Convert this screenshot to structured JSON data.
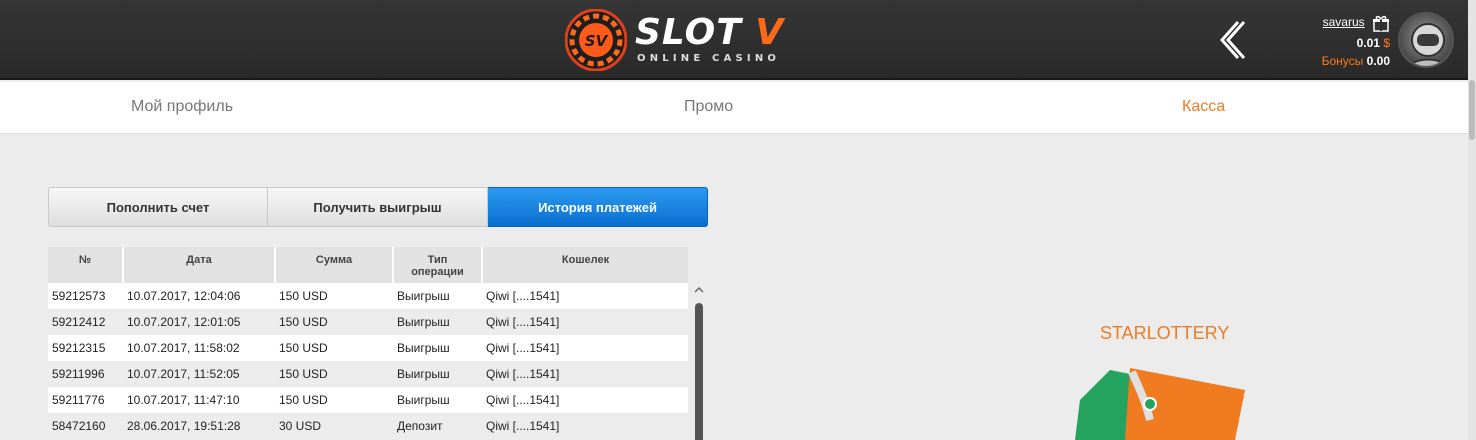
{
  "header": {
    "logo_text": "SLOT",
    "logo_letter": "V",
    "logo_sub": "ONLINE CASINO",
    "username": "savarus",
    "balance_value": "0.01",
    "balance_currency": "$",
    "bonus_label": "Бонусы",
    "bonus_value": "0.00"
  },
  "nav": {
    "profile": "Мой профиль",
    "promo": "Промо",
    "cashier": "Касса",
    "active": "cashier"
  },
  "tabs": {
    "deposit": "Пополнить счет",
    "withdraw": "Получить выигрыш",
    "history": "История платежей",
    "active": "history"
  },
  "table": {
    "headers": [
      "№",
      "Дата",
      "Сумма",
      "Тип операции",
      "Кошелек"
    ],
    "rows": [
      [
        "59212573",
        "10.07.2017, 12:04:06",
        "150 USD",
        "Выигрыш",
        "Qiwi [....1541]"
      ],
      [
        "59212412",
        "10.07.2017, 12:01:05",
        "150 USD",
        "Выигрыш",
        "Qiwi [....1541]"
      ],
      [
        "59212315",
        "10.07.2017, 11:58:02",
        "150 USD",
        "Выигрыш",
        "Qiwi [....1541]"
      ],
      [
        "59211996",
        "10.07.2017, 11:52:05",
        "150 USD",
        "Выигрыш",
        "Qiwi [....1541]"
      ],
      [
        "59211776",
        "10.07.2017, 11:47:10",
        "150 USD",
        "Выигрыш",
        "Qiwi [....1541]"
      ],
      [
        "58472160",
        "28.06.2017, 19:51:28",
        "30 USD",
        "Депозит",
        "Qiwi [....1541]"
      ]
    ]
  },
  "promo": {
    "title": "STARLOTTERY"
  },
  "colors": {
    "accent": "#f07b20",
    "active_tab": "#1a84e0",
    "header_bg": "#2f2f2f"
  },
  "icons": {
    "back": "chevron-left-icon",
    "gift": "gift-icon",
    "scroll_up": "chevron-up-icon"
  }
}
